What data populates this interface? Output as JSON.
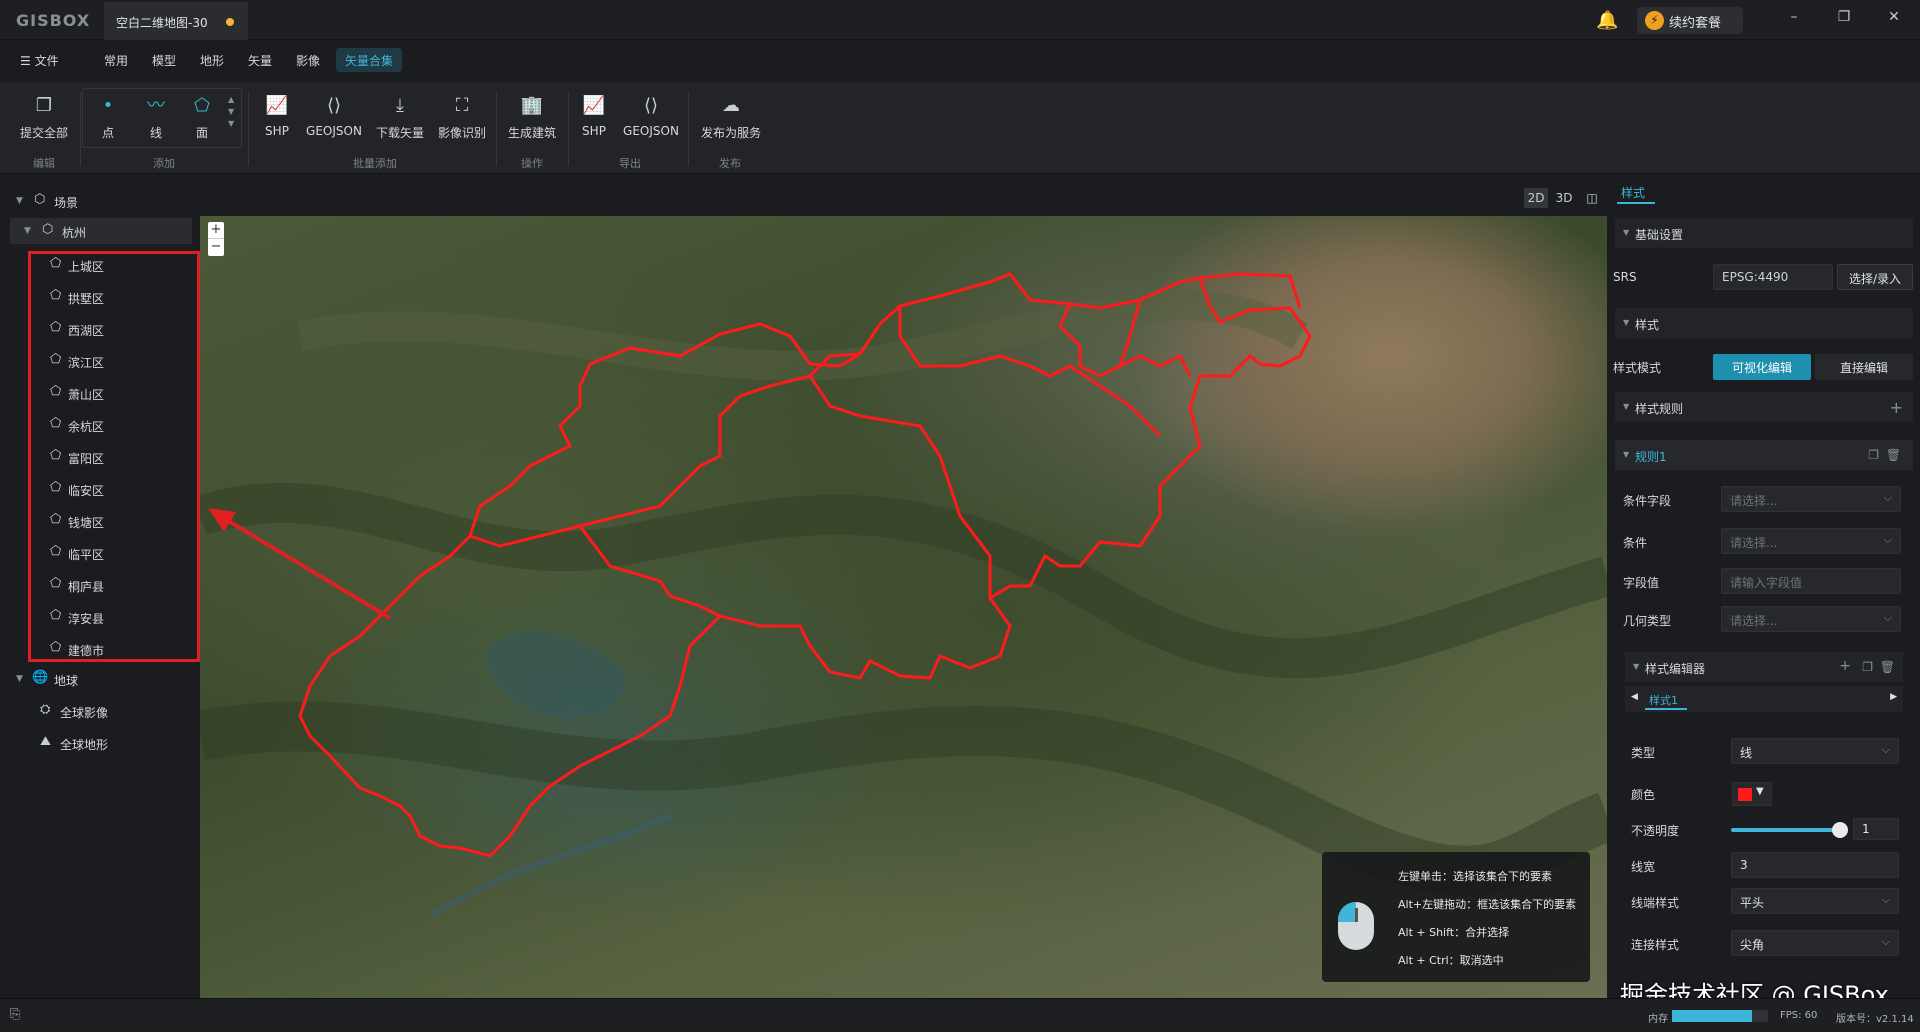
{
  "app": {
    "logo": "GISBOX",
    "doc_tab": "空白二维地图-30",
    "renew_label": "续约套餐"
  },
  "menu": {
    "file": "文件",
    "items": [
      "常用",
      "模型",
      "地形",
      "矢量",
      "影像"
    ],
    "active": "矢量合集"
  },
  "ribbon": {
    "tools": {
      "submit_all": "提交全部",
      "point": "点",
      "line": "线",
      "polygon": "面",
      "shp_import": "SHP",
      "geojson_import": "GEOJSON",
      "download_vector": "下载矢量",
      "image_recognition": "影像识别",
      "generate_building": "生成建筑",
      "shp_export": "SHP",
      "geojson_export": "GEOJSON",
      "publish_service": "发布为服务"
    },
    "groups": {
      "edit": "编辑",
      "add": "添加",
      "batch_add": "批量添加",
      "operation": "操作",
      "export": "导出",
      "publish": "发布"
    }
  },
  "tree": {
    "scene": "场景",
    "city": "杭州",
    "districts": [
      "上城区",
      "拱墅区",
      "西湖区",
      "滨江区",
      "萧山区",
      "余杭区",
      "富阳区",
      "临安区",
      "钱塘区",
      "临平区",
      "桐庐县",
      "淳安县",
      "建德市"
    ],
    "earth": "地球",
    "global_image": "全球影像",
    "global_terrain": "全球地形"
  },
  "view_toggles": [
    "2D",
    "3D"
  ],
  "hint": {
    "lines": [
      "左键单击：选择该集合下的要素",
      "Alt+左键拖动：框选该集合下的要素",
      "Alt + Shift：合并选择",
      "Alt + Ctrl：取消选中"
    ]
  },
  "right_panel": {
    "tab": "样式",
    "basic_settings": "基础设置",
    "srs_label": "SRS",
    "srs_value": "EPSG:4490",
    "srs_button": "选择/录入",
    "style_section": "样式",
    "style_mode_label": "样式模式",
    "mode_visual": "可视化编辑",
    "mode_direct": "直接编辑",
    "style_rules": "样式规则",
    "rule_name": "规则1",
    "condition_field_label": "条件字段",
    "condition_field_placeholder": "请选择...",
    "condition_label": "条件",
    "condition_placeholder": "请选择...",
    "field_value_label": "字段值",
    "field_value_placeholder": "请输入字段值",
    "geometry_type_label": "几何类型",
    "geometry_type_placeholder": "请选择...",
    "style_editor": "样式编辑器",
    "style_tab": "样式1",
    "type_label": "类型",
    "type_value": "线",
    "color_label": "颜色",
    "color_value": "#ff1b1b",
    "opacity_label": "不透明度",
    "opacity_value": "1",
    "line_width_label": "线宽",
    "line_width_value": "3",
    "cap_style_label": "线端样式",
    "cap_style_value": "平头",
    "join_style_label": "连接样式",
    "join_style_value": "尖角"
  },
  "status": {
    "memory_label": "内存",
    "memory_fraction": 0.83,
    "fps": "FPS: 60",
    "version": "版本号：v2.1.14"
  },
  "watermark": "掘金技术社区 @ GISBox",
  "colors": {
    "accent": "#3fb6d8",
    "highlight_red": "#e02020",
    "boundary_red": "#ff1b1b"
  }
}
